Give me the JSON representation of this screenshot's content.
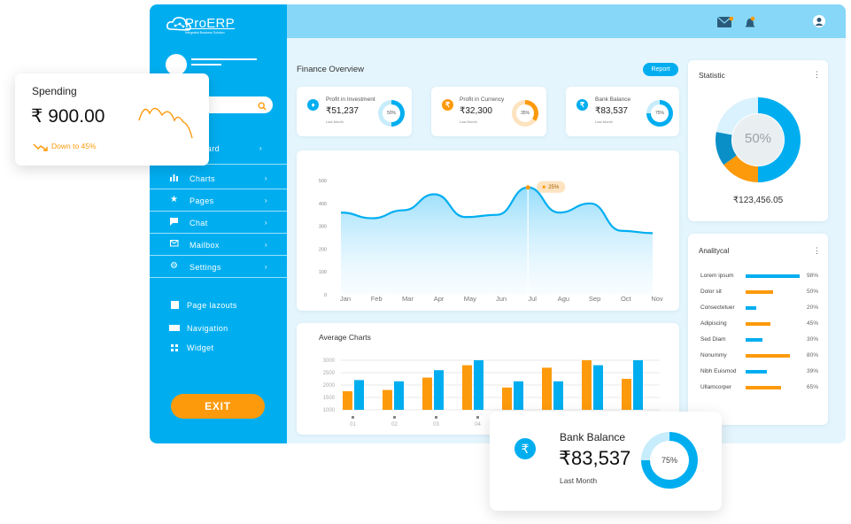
{
  "brand": {
    "name": "ProERP",
    "tagline": "Integrated Business Solution"
  },
  "search": {
    "placeholder": ""
  },
  "nav": {
    "dashboard": "board",
    "items": [
      {
        "label": "Charts",
        "icon": "bar-chart-icon"
      },
      {
        "label": "Pages",
        "icon": "star-icon"
      },
      {
        "label": "Chat",
        "icon": "chat-icon"
      },
      {
        "label": "Mailbox",
        "icon": "mail-icon"
      },
      {
        "label": "Settings",
        "icon": "gear-icon"
      }
    ],
    "sections": [
      "Page lazouts",
      "Navigation",
      "Widget"
    ],
    "exit": "EXIT"
  },
  "header": {
    "mail_badge": "",
    "bell_badge": ""
  },
  "finance": {
    "title": "Finance Overview",
    "report_label": "Report",
    "cards": [
      {
        "title": "Profit in Investment",
        "value": "₹51,237",
        "sub": "Last Month",
        "pct": "50%",
        "percent": 50,
        "color": "#00aef0",
        "icon_color": "#00aef0"
      },
      {
        "title": "Profit in Currency",
        "value": "₹32,300",
        "sub": "Last Month",
        "pct": "35%",
        "percent": 35,
        "color": "#fd9a0c",
        "icon_color": "#fd9a0c"
      },
      {
        "title": "Bank Balance",
        "value": "₹83,537",
        "sub": "Last Month",
        "pct": "75%",
        "percent": 75,
        "color": "#00aef0",
        "icon_color": "#00aef0"
      }
    ]
  },
  "area_chart": {
    "tooltip": "25%"
  },
  "bar_chart": {
    "title": "Average Charts"
  },
  "statistic": {
    "title": "Statistic",
    "center_label": "50%",
    "total": "₹123,456.05"
  },
  "analytical": {
    "title": "Analitycal",
    "rows": [
      {
        "label": "Lorem ipsum",
        "value": 98,
        "pct": "98%",
        "color": "#00aef0"
      },
      {
        "label": "Dolor sit",
        "value": 50,
        "pct": "50%",
        "color": "#fd9a0c"
      },
      {
        "label": "Consectetuer",
        "value": 20,
        "pct": "20%",
        "color": "#00aef0"
      },
      {
        "label": "Adipiscing",
        "value": 45,
        "pct": "45%",
        "color": "#fd9a0c"
      },
      {
        "label": "Sed Diam",
        "value": 30,
        "pct": "30%",
        "color": "#00aef0"
      },
      {
        "label": "Nonummy",
        "value": 80,
        "pct": "80%",
        "color": "#fd9a0c"
      },
      {
        "label": "Nibh Euismod",
        "value": 39,
        "pct": "39%",
        "color": "#00aef0"
      },
      {
        "label": "Ullamcorper",
        "value": 65,
        "pct": "65%",
        "color": "#fd9a0c"
      }
    ]
  },
  "spending": {
    "title": "Spending",
    "amount": "₹ 900.00",
    "trend": "Down to 45%"
  },
  "bank_popup": {
    "title": "Bank Balance",
    "amount": "₹83,537",
    "sub": "Last Month",
    "pct": "75%",
    "percent": 75
  },
  "colors": {
    "primary": "#00aef0",
    "accent": "#fd9a0c",
    "background": "#e4f5fd"
  },
  "chart_data": [
    {
      "type": "area",
      "categories": [
        "Jan",
        "Feb",
        "Mar",
        "Apr",
        "May",
        "Jun",
        "Jul",
        "Agu",
        "Sep",
        "Oct",
        "Nov"
      ],
      "yticks": [
        0,
        100,
        200,
        300,
        400,
        500
      ],
      "ylim": [
        0,
        500
      ],
      "values": [
        360,
        335,
        370,
        440,
        340,
        350,
        470,
        360,
        400,
        280,
        270
      ],
      "annotation": {
        "label": "25%",
        "category": "Jul"
      },
      "xlabel": "",
      "ylabel": ""
    },
    {
      "type": "bar",
      "title": "Average Charts",
      "categories": [
        "01",
        "02",
        "03",
        "04",
        "",
        "",
        "",
        "",
        "",
        "",
        "",
        ""
      ],
      "yticks": [
        1000,
        1500,
        2000,
        2500,
        3000
      ],
      "ylim": [
        1000,
        3000
      ],
      "series": [
        {
          "color": "#fd9a0c",
          "values": [
            1750,
            1800,
            2300,
            2800,
            1900,
            2700,
            3000,
            2250
          ]
        },
        {
          "color": "#00aef0",
          "values": [
            2200,
            2150,
            2600,
            3000,
            2150,
            2150,
            2800,
            3000
          ]
        }
      ]
    },
    {
      "type": "pie",
      "title": "Statistic",
      "center_label": "50%",
      "slices": [
        {
          "value": 50,
          "color": "#00aef0"
        },
        {
          "value": 15,
          "color": "#fd9a0c"
        },
        {
          "value": 13,
          "color": "#0b8fc7"
        },
        {
          "value": 22,
          "color": "#d9f2fd"
        }
      ]
    }
  ]
}
